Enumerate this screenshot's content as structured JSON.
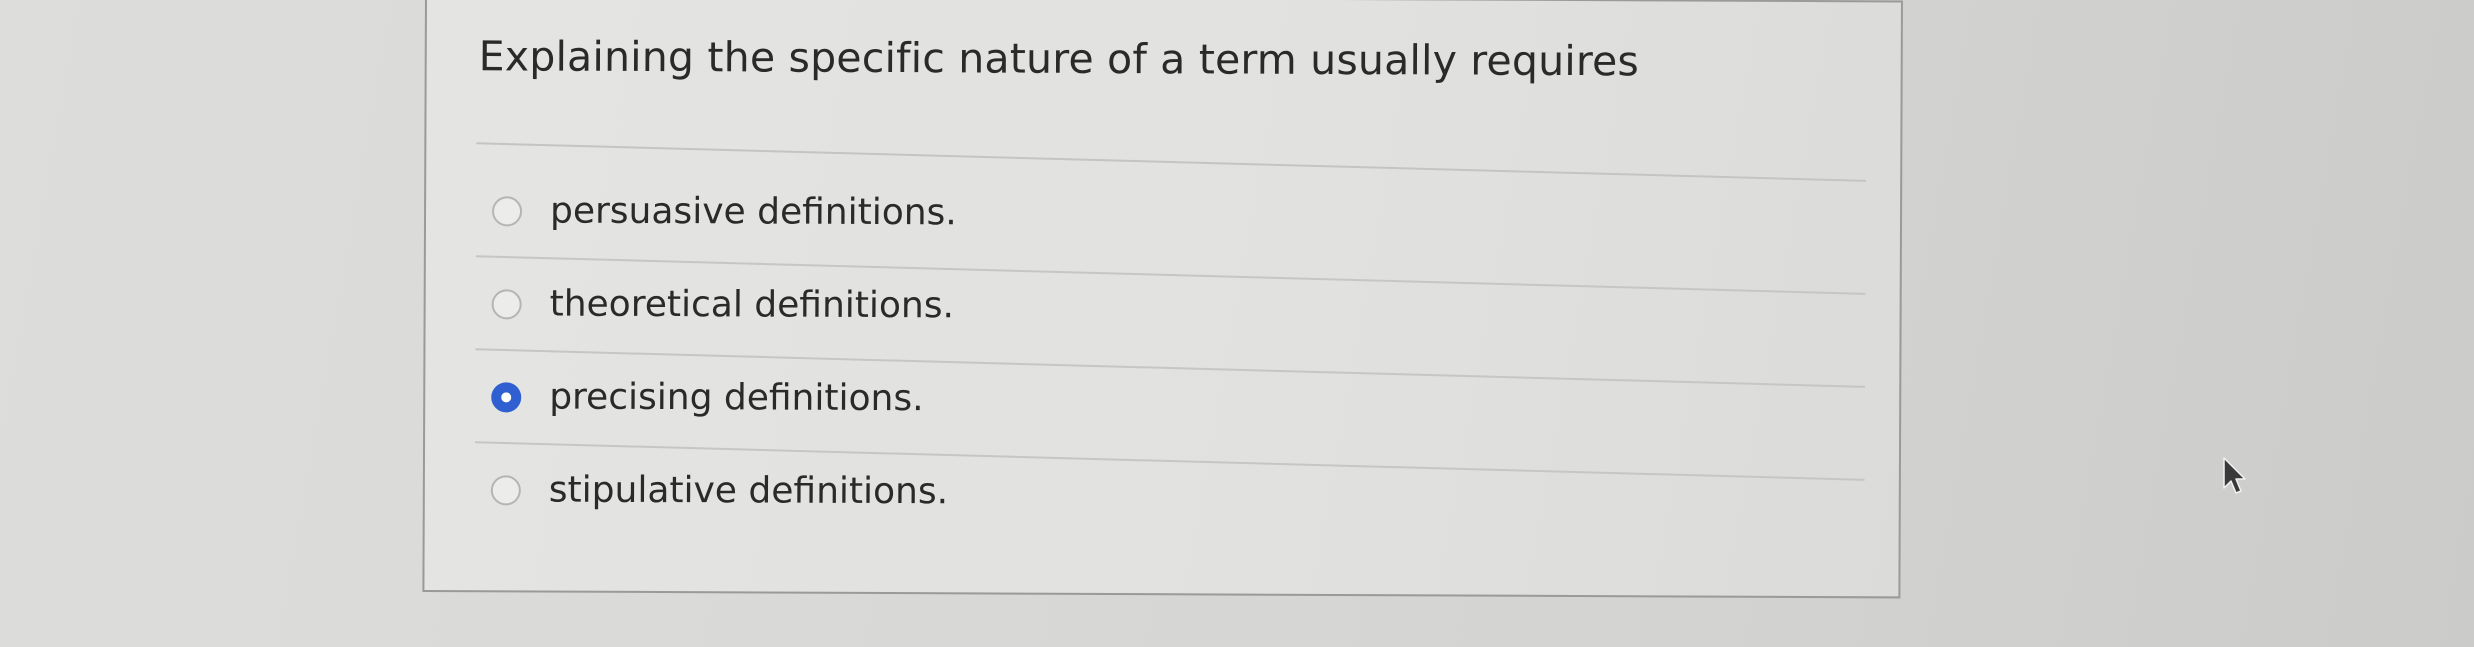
{
  "question": {
    "text": "Explaining the specific nature of a term usually requires"
  },
  "options": [
    {
      "label": "persuasive definitions.",
      "selected": false
    },
    {
      "label": "theoretical definitions.",
      "selected": false
    },
    {
      "label": "precising definitions.",
      "selected": true
    },
    {
      "label": "stipulative definitions.",
      "selected": false
    }
  ],
  "colors": {
    "accent": "#2f5fd0",
    "text": "#2a2a2a"
  },
  "icons": {
    "cursor": "mouse-pointer-icon"
  }
}
